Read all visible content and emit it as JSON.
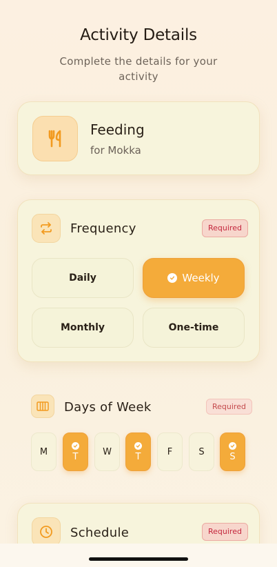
{
  "header": {
    "title": "Activity Details",
    "subtitle": "Complete the details for your activity"
  },
  "activity": {
    "icon": "fork-knife-icon",
    "name": "Feeding",
    "subtitle": "for Mokka"
  },
  "frequency": {
    "title": "Frequency",
    "badge": "Required",
    "options": [
      {
        "label": "Daily",
        "selected": false
      },
      {
        "label": "Weekly",
        "selected": true
      },
      {
        "label": "Monthly",
        "selected": false
      },
      {
        "label": "One-time",
        "selected": false
      }
    ]
  },
  "days_of_week": {
    "title": "Days of Week",
    "badge": "Required",
    "days": [
      {
        "label": "M",
        "selected": false
      },
      {
        "label": "T",
        "selected": true
      },
      {
        "label": "W",
        "selected": false
      },
      {
        "label": "T",
        "selected": true
      },
      {
        "label": "F",
        "selected": false
      },
      {
        "label": "S",
        "selected": false
      },
      {
        "label": "S",
        "selected": true
      }
    ]
  },
  "schedule": {
    "title": "Schedule",
    "badge": "Required"
  },
  "colors": {
    "accent": "#f4ab3a",
    "required_text": "#c4273d",
    "card_bg": "#f7f4dc"
  }
}
